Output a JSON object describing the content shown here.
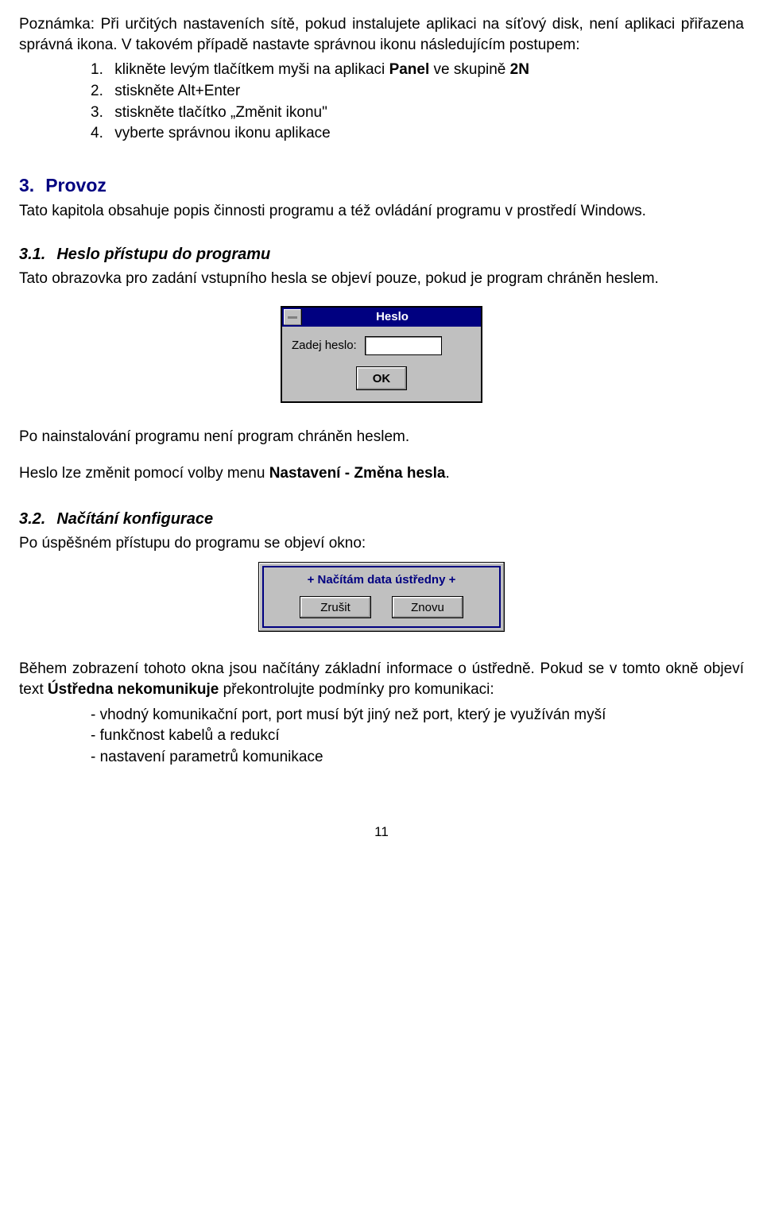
{
  "note": {
    "para1a": "Poznámka: Při určitých nastaveních sítě, pokud instalujete aplikaci na síťový disk, není aplikaci přiřazena správná ikona. V",
    "para1b": " takovém případě nastavte správnou ikonu následujícím postupem:",
    "steps": [
      {
        "n": "1.",
        "pre": "klikněte levým tlačítkem myši na aplikaci ",
        "bold": "Panel",
        "mid": " ve skupině ",
        "bold2": "2N"
      },
      {
        "n": "2.",
        "text": "stiskněte Alt+Enter"
      },
      {
        "n": "3.",
        "text": "stiskněte tlačítko „Změnit ikonu\""
      },
      {
        "n": "4.",
        "text": "vyberte správnou ikonu aplikace"
      }
    ]
  },
  "sec3": {
    "num": "3.",
    "title": "Provoz",
    "para": "Tato kapitola obsahuje popis činnosti programu a též ovládání programu v prostředí Windows."
  },
  "sec31": {
    "num": "3.1.",
    "title": "Heslo přístupu do programu",
    "para": "Tato obrazovka pro zadání vstupního hesla se objeví pouze, pokud je program chráněn heslem."
  },
  "dlg1": {
    "title": "Heslo",
    "label": "Zadej heslo:",
    "ok": "OK"
  },
  "after31": {
    "p1": "Po nainstalování programu není program chráněn heslem.",
    "p2a": "Heslo lze změnit pomocí volby menu ",
    "p2b": "Nastavení - Změna hesla",
    "p2c": "."
  },
  "sec32": {
    "num": "3.2.",
    "title": "Načítání konfigurace",
    "para": "Po úspěšném přístupu do programu se objeví okno:"
  },
  "dlg2": {
    "title": "+ Načítám data ústředny +",
    "cancel": "Zrušit",
    "again": "Znovu"
  },
  "after32": {
    "p1a": "Během zobrazení tohoto okna jsou načítány základní informace o ústředně. Pokud se v",
    "p1b": " tomto okně objeví text ",
    "p1bold": "Ústředna nekomunikuje",
    "p1c": " překontrolujte podmínky pro komunikaci:",
    "bullets": [
      "- vhodný komunikační port, port musí být jiný než port, který je využíván myší",
      "- funkčnost  kabelů a redukcí",
      "- nastavení parametrů komunikace"
    ]
  },
  "page": "11"
}
